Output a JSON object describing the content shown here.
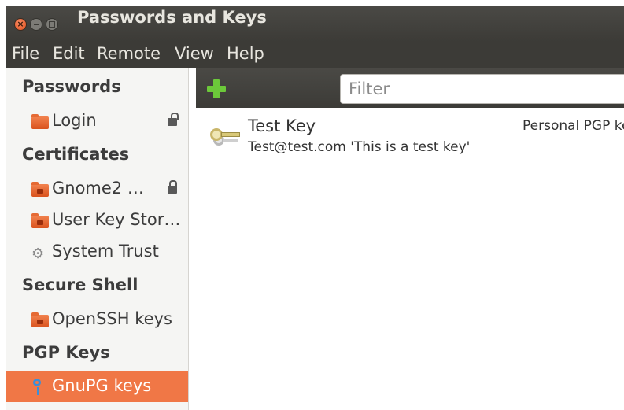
{
  "window": {
    "title": "Passwords and Keys",
    "close_glyph": "×"
  },
  "menubar": {
    "items": [
      "File",
      "Edit",
      "Remote",
      "View",
      "Help"
    ]
  },
  "sidebar": {
    "sections": [
      {
        "heading": "Passwords",
        "items": [
          {
            "label": "Login",
            "icon": "folder-icon",
            "lock": "unlocked"
          }
        ]
      },
      {
        "heading": "Certificates",
        "items": [
          {
            "label": "Gnome2 …",
            "icon": "folder-icon",
            "lock": "locked"
          },
          {
            "label": "User Key Stor…",
            "icon": "folder-icon"
          },
          {
            "label": "System Trust",
            "icon": "gear-icon",
            "glyph": "⚙"
          }
        ]
      },
      {
        "heading": "Secure Shell",
        "items": [
          {
            "label": "OpenSSH keys",
            "icon": "folder-icon"
          }
        ]
      },
      {
        "heading": "PGP Keys",
        "items": [
          {
            "label": "GnuPG keys",
            "icon": "key-icon",
            "selected": true
          }
        ]
      }
    ]
  },
  "toolbar": {
    "add_icon": "plus-icon",
    "filter_placeholder": "Filter"
  },
  "keys": [
    {
      "name": "Test Key",
      "description": "Test@test.com 'This is a test key'",
      "type": "Personal PGP key"
    }
  ],
  "colors": {
    "titlebar": "#3c3b37",
    "selected": "#f07746",
    "folder": "#e2612a",
    "add": "#6cc93a"
  }
}
